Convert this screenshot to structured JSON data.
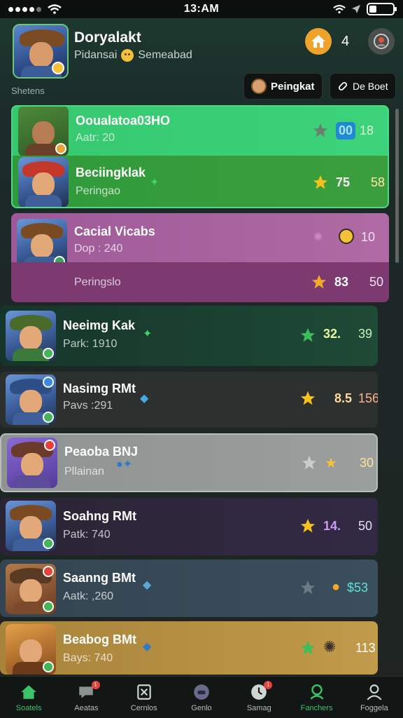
{
  "status": {
    "time": "13:AM"
  },
  "header": {
    "profile_name": "Doryalakt",
    "profile_sub_a": "Pidansai",
    "profile_sub_b": "Semeabad",
    "home_count": "4",
    "section_label": "Shetens",
    "pill_primary": "Peingkat",
    "pill_secondary": "De Boet"
  },
  "rows": [
    {
      "name": "Ooualatoa03HO",
      "sub": "Aatr: 20",
      "v1": "00",
      "v2": "18"
    },
    {
      "name": "Beciingklak",
      "sub": "Peringao",
      "v1": "75",
      "v2": "58"
    },
    {
      "name": "Cacial Vicabs",
      "sub": "Dop : 240",
      "v1": "",
      "v2": "10"
    },
    {
      "name": "",
      "sub": "Peringslo",
      "v1": "83",
      "v2": "50"
    },
    {
      "name": "Neeimg Kak",
      "sub": "Park: 1910",
      "v1": "32.",
      "v2": "39"
    },
    {
      "name": "Nasimg RMt",
      "sub": "Pavs :291",
      "v1": "8.5",
      "v2": "156"
    },
    {
      "name": "Peaoba BNJ",
      "sub": "Pllainan",
      "v1": "",
      "v2": "30"
    },
    {
      "name": "Soahng RMt",
      "sub": "Patk: 740",
      "v1": "14.",
      "v2": "50"
    },
    {
      "name": "Saanng BMt",
      "sub": "Aatk: ,260",
      "v1": "",
      "v2": "$53"
    },
    {
      "name": "Beabog BMt",
      "sub": "Bays: 740",
      "v1": "",
      "v2": "113"
    }
  ],
  "nav": [
    {
      "label": "Soatels"
    },
    {
      "label": "Aeatas"
    },
    {
      "label": "Cernlos"
    },
    {
      "label": "Genlo"
    },
    {
      "label": "Samag"
    },
    {
      "label": "Fanchers"
    },
    {
      "label": "Foggela"
    }
  ]
}
